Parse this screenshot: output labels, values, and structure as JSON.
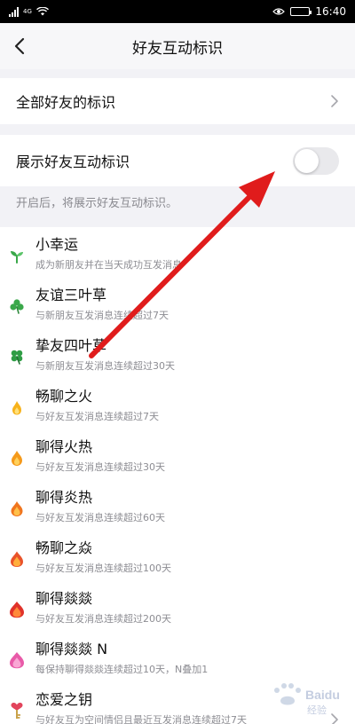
{
  "status_bar": {
    "signal_tag": "4G",
    "time": "16:40"
  },
  "nav": {
    "title": "好友互动标识"
  },
  "all_friends_row": {
    "label": "全部好友的标识"
  },
  "toggle_row": {
    "label": "展示好友互动标识",
    "enabled": false
  },
  "hint": "开启后，将展示好友互动标识。",
  "badges": [
    {
      "title": "小幸运",
      "desc": "成为新朋友并在当天成功互发消息",
      "icon": "sprout-icon"
    },
    {
      "title": "友谊三叶草",
      "desc": "与新朋友互发消息连续超过7天",
      "icon": "three-leaf-clover-icon"
    },
    {
      "title": "挚友四叶草",
      "desc": "与新朋友互发消息连续超过30天",
      "icon": "four-leaf-clover-icon"
    },
    {
      "title": "畅聊之火",
      "desc": "与好友互发消息连续超过7天",
      "icon": "small-flame-icon"
    },
    {
      "title": "聊得火热",
      "desc": "与好友互发消息连续超过30天",
      "icon": "flame-icon"
    },
    {
      "title": "聊得炎热",
      "desc": "与好友互发消息连续超过60天",
      "icon": "double-flame-icon"
    },
    {
      "title": "畅聊之焱",
      "desc": "与好友互发消息连续超过100天",
      "icon": "triple-flame-icon"
    },
    {
      "title": "聊得燚燚",
      "desc": "与好友互发消息连续超过200天",
      "icon": "big-flame-icon"
    },
    {
      "title": "聊得燚燚 N",
      "desc": "每保持聊得燚燚连续超过10天，N叠加1",
      "icon": "pink-flame-icon"
    },
    {
      "title": "恋爱之钥",
      "desc": "与好友互为空间情侣且最近互发消息连续超过7天",
      "icon": "key-heart-icon"
    }
  ],
  "watermark": {
    "text": "Baidu经验"
  },
  "colors": {
    "arrow": "#e01c1c",
    "clover": "#3aa84a",
    "flame": "#f59a1b",
    "flame_red": "#e9422a",
    "flame_pink": "#e85aa8"
  }
}
